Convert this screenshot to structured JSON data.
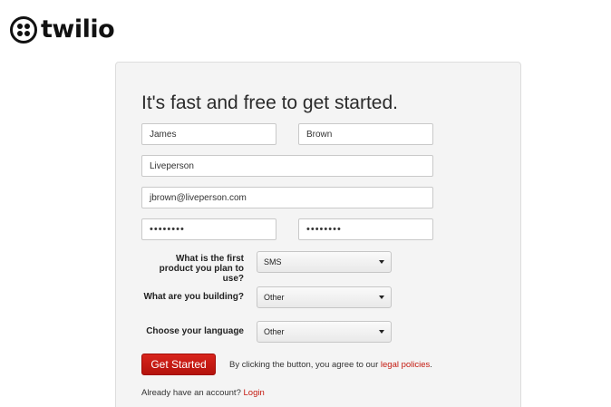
{
  "brand": {
    "logo_text": "twilio"
  },
  "form": {
    "headline": "It's fast and free to get started.",
    "first_name": "James",
    "last_name": "Brown",
    "company": "Liveperson",
    "email": "jbrown@liveperson.com",
    "password": "••••••••",
    "password_confirm": "••••••••",
    "q_product_label": "What is the first product you plan to use?",
    "q_product_value": "SMS",
    "q_building_label": "What are you building?",
    "q_building_value": "Other",
    "q_language_label": "Choose your language",
    "q_language_value": "Other",
    "submit_label": "Get Started",
    "terms_text": "By clicking the button, you agree to our",
    "terms_link": "legal policies",
    "terms_suffix": ".",
    "account_text": "Already have an account?",
    "login_link": "Login"
  },
  "colors": {
    "accent": "#c4190f",
    "button": "#c71a12",
    "card_bg": "#f4f4f4"
  }
}
